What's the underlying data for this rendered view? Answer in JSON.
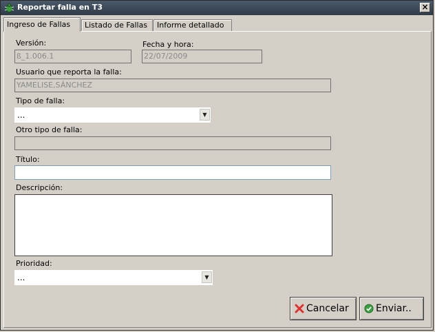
{
  "window": {
    "title": "Reportar falla en T3",
    "close_glyph": "×"
  },
  "tabs": [
    {
      "label": "Ingreso de Fallas",
      "active": true
    },
    {
      "label": "Listado de Fallas",
      "active": false
    },
    {
      "label": "Informe detallado",
      "active": false
    }
  ],
  "form": {
    "version": {
      "label": "Versión:",
      "value": "ß_1.006.1"
    },
    "fecha": {
      "label": "Fecha y hora:",
      "value": "22/07/2009"
    },
    "usuario": {
      "label": "Usuario que reporta la falla:",
      "value": "YAMELISE,SÁNCHEZ"
    },
    "tipo": {
      "label": "Tipo de falla:",
      "value": "..."
    },
    "otro_tipo": {
      "label": "Otro tipo de falla:",
      "value": ""
    },
    "titulo": {
      "label": "Título:",
      "value": ""
    },
    "descripcion": {
      "label": "Descripción:",
      "value": ""
    },
    "prioridad": {
      "label": "Prioridad:",
      "value": "..."
    }
  },
  "buttons": {
    "cancel": {
      "label": "Cancelar",
      "icon": "red-x-icon"
    },
    "send": {
      "label": "Enviar..",
      "icon": "green-check-icon"
    }
  },
  "icons": {
    "app": "bug-icon",
    "dropdown": "chevron-down-icon"
  },
  "colors": {
    "titlebar": "#3a4654",
    "cancel_icon": "#e03030",
    "send_icon": "#3aa040"
  }
}
